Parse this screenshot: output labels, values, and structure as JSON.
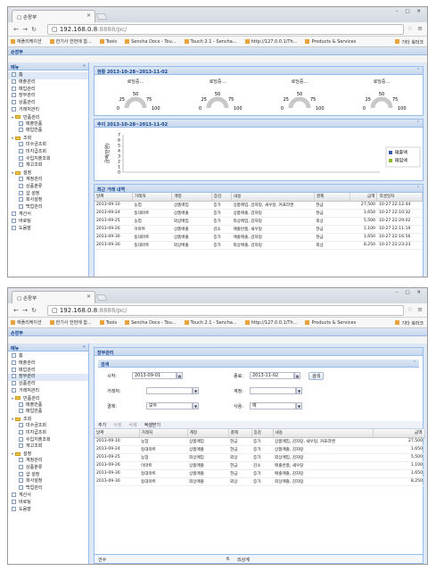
{
  "browser": {
    "tab_title": "손장부",
    "url_host": "192.168.0.8",
    "url_rest": ":8888/pc/",
    "bookmarks": [
      "애플리케이션",
      "한기사 한번에 합...",
      "Tools",
      "Sencha Docs - Tou...",
      "Touch 2.1 - Sencha...",
      "http://127.0.0.1/Th...",
      "Products & Services"
    ],
    "bookmarks_other": "기타 북마크"
  },
  "app": {
    "title": "손장부",
    "menu_title": "메뉴",
    "tree": [
      {
        "label": "홈",
        "level": 0,
        "type": "leaf"
      },
      {
        "label": "매출관리",
        "level": 0,
        "type": "leaf"
      },
      {
        "label": "매입관리",
        "level": 0,
        "type": "leaf"
      },
      {
        "label": "장부관리",
        "level": 0,
        "type": "leaf"
      },
      {
        "label": "상품관리",
        "level": 0,
        "type": "leaf"
      },
      {
        "label": "거래처관리",
        "level": 0,
        "type": "leaf"
      },
      {
        "label": "반품관리",
        "level": 0,
        "type": "folder"
      },
      {
        "label": "매출반품",
        "level": 1,
        "type": "leaf"
      },
      {
        "label": "매입반품",
        "level": 1,
        "type": "leaf"
      },
      {
        "label": "조회",
        "level": 0,
        "type": "folder"
      },
      {
        "label": "미수금조회",
        "level": 1,
        "type": "leaf"
      },
      {
        "label": "미지급조회",
        "level": 1,
        "type": "leaf"
      },
      {
        "label": "수입지출조회",
        "level": 1,
        "type": "leaf"
      },
      {
        "label": "재고조회",
        "level": 1,
        "type": "leaf"
      },
      {
        "label": "설정",
        "level": 0,
        "type": "folder"
      },
      {
        "label": "계정관리",
        "level": 1,
        "type": "leaf"
      },
      {
        "label": "상품분류",
        "level": 1,
        "type": "leaf"
      },
      {
        "label": "샵 설정",
        "level": 1,
        "type": "leaf"
      },
      {
        "label": "회사설정",
        "level": 1,
        "type": "leaf"
      },
      {
        "label": "백업관리",
        "level": 1,
        "type": "leaf"
      },
      {
        "label": "계산서",
        "level": 0,
        "type": "leaf"
      },
      {
        "label": "바로팅",
        "level": 0,
        "type": "leaf"
      },
      {
        "label": "도움말",
        "level": 0,
        "type": "leaf"
      }
    ]
  },
  "home": {
    "tab_label": "홈",
    "gauge_panel_title": "현황 2013-10-28~2013-11-02",
    "gauges": [
      {
        "label": "로딩중..."
      },
      {
        "label": "로딩중..."
      },
      {
        "label": "로딩중..."
      },
      {
        "label": "로딩중..."
      }
    ],
    "gauge_ticks": [
      "0",
      "25",
      "50",
      "75",
      "100"
    ],
    "chart_panel_title": "추이 2013-10-28~2013-11-02",
    "chart_data": {
      "type": "line",
      "y_ticks": [
        "0",
        "1",
        "2",
        "3",
        "4",
        "5",
        "6",
        "7"
      ],
      "ylabel": "금액(만원)",
      "ylim": [
        0,
        7
      ],
      "legend": [
        {
          "name": "매출액",
          "color": "#3a5aa8"
        },
        {
          "name": "매입액",
          "color": "#8bb72b"
        }
      ],
      "legend_position": "right"
    },
    "recent_panel_title": "최근 거래 내역",
    "recent_columns": [
      "날짜",
      "거래처",
      "계정",
      "증감",
      "내용",
      "결제",
      "금액",
      "작성일자"
    ],
    "recent_rows": [
      [
        "2013-09-10",
        "농업",
        "상품매입",
        "증가",
        "상품매입, 감자탕, 새우탕, 커프라멘",
        "현금",
        "27,500",
        "10-27 22:12:44"
      ],
      [
        "2013-09-24",
        "동대마트",
        "상품매출",
        "증가",
        "상품매출, 감자탕",
        "현금",
        "1,650",
        "10-27 22:10:32"
      ],
      [
        "2013-09-25",
        "농업",
        "외상매입",
        "증가",
        "외상매입, 감자탕",
        "외상",
        "5,500",
        "10-27 22:29:02"
      ],
      [
        "2013-09-26",
        "이마트",
        "상품매출",
        "감소",
        "매출반품, 새우탕",
        "현금",
        "1,100",
        "10-27 22:11:19"
      ],
      [
        "2013-09-30",
        "동대마트",
        "상품매출",
        "증가",
        "매출매출, 감자탕",
        "현금",
        "1,650",
        "10-27 22:16:56"
      ],
      [
        "2013-09-30",
        "동대마트",
        "외상매출",
        "증가",
        "외상매출, 감자탕",
        "외상",
        "8,250",
        "10-27 22:23:23"
      ]
    ]
  },
  "ledger": {
    "panel_title": "장부관리",
    "search_title": "검색",
    "start_label": "시작:",
    "start_value": "2013-09-01",
    "end_label": "종료:",
    "end_value": "2013-11-02",
    "search_button": "검색",
    "vendor_label": "거래처:",
    "account_label": "계정:",
    "payment_label": "결제:",
    "payment_value": "모두",
    "use_label": "사용:",
    "use_value": "예",
    "toolbar": [
      "추가",
      "수정",
      "삭제",
      "엑셀받기"
    ],
    "columns": [
      "날짜",
      "거래처",
      "계정",
      "결제",
      "증감",
      "내용",
      "금액"
    ],
    "rows": [
      [
        "2013-09-10",
        "농업",
        "상품매입",
        "현금",
        "증가",
        "상품매입, 감자탕, 새우탕, 커프라멘",
        "27,500"
      ],
      [
        "2013-09-24",
        "동대마트",
        "상품매출",
        "현금",
        "증가",
        "상품매출, 감자탕",
        "1,650"
      ],
      [
        "2013-09-25",
        "농업",
        "외상매입",
        "외상",
        "증가",
        "외상매입, 감자탕",
        "5,500"
      ],
      [
        "2013-09-26",
        "이마트",
        "상품매출",
        "현금",
        "감소",
        "매출반품, 새우탕",
        "1,100"
      ],
      [
        "2013-09-30",
        "동대마트",
        "상품매출",
        "현금",
        "증가",
        "매출매출, 감자탕",
        "1,650"
      ],
      [
        "2013-09-30",
        "동대마트",
        "외상매출",
        "외상",
        "증가",
        "외상매출, 감자탕",
        "8,250"
      ]
    ],
    "summary_label": "건수",
    "summary_count": "6",
    "summary_extra": "외상계"
  }
}
